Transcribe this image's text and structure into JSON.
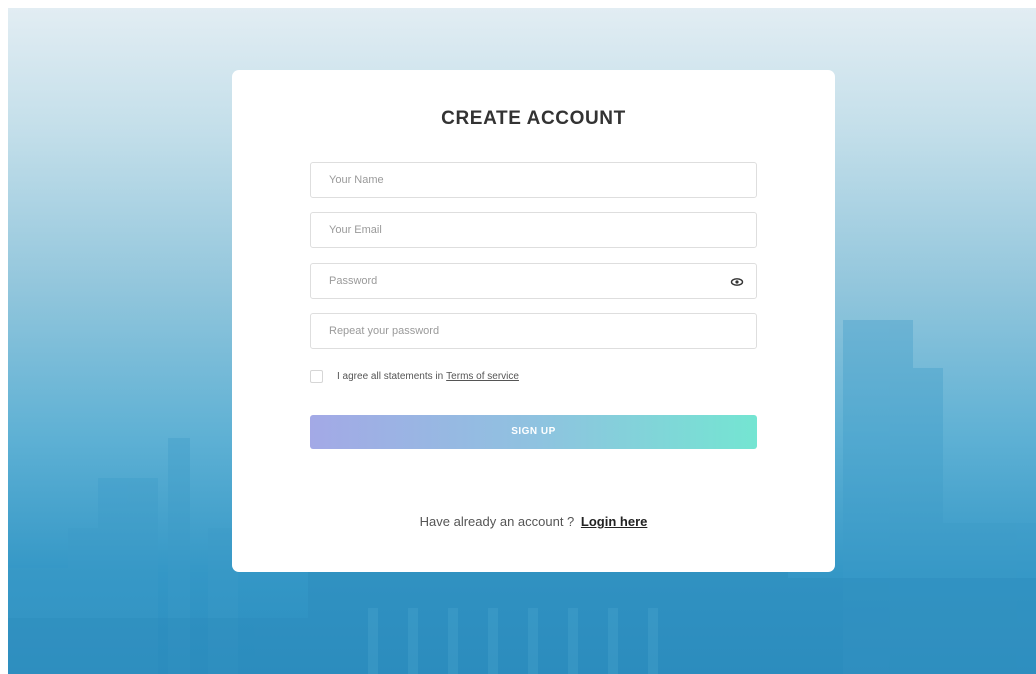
{
  "form": {
    "title": "CREATE ACCOUNT",
    "name_placeholder": "Your Name",
    "email_placeholder": "Your Email",
    "password_placeholder": "Password",
    "repeat_password_placeholder": "Repeat your password",
    "password_toggle_icon": "eye-icon",
    "terms_checked": false,
    "terms_text": "I agree all statements in",
    "terms_link": "Terms of service",
    "signup_label": "SIGN UP",
    "login_prompt": "Have already an account ?",
    "login_link": "Login here"
  },
  "colors": {
    "background_top": "#e2edf3",
    "background_bottom": "#2b8dbf",
    "button_gradient_start": "#a3a9e6",
    "button_gradient_end": "#74e5d2",
    "title": "#333333"
  }
}
